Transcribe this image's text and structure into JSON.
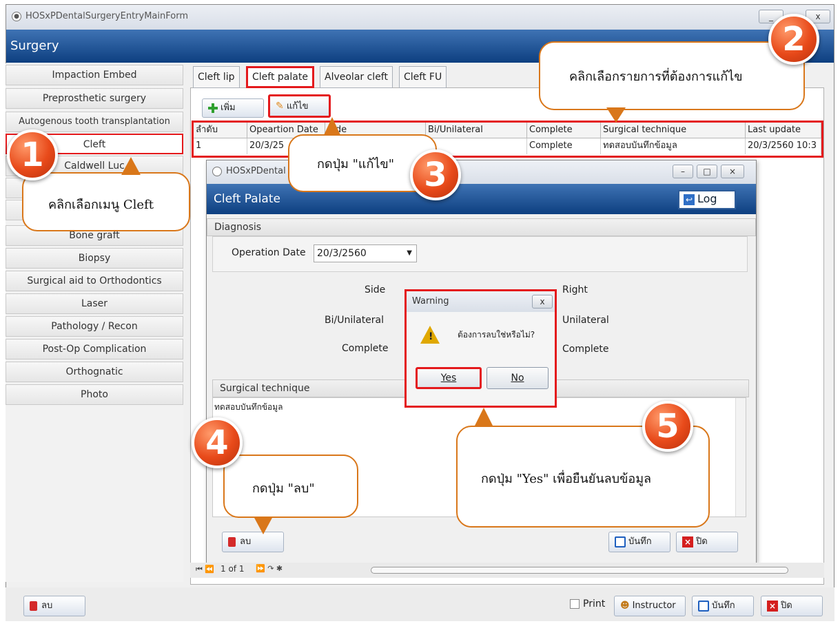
{
  "main_window": {
    "title": "HOSxPDentalSurgeryEntryMainForm",
    "header": "Surgery",
    "min_btn": "_",
    "close_btn": "x"
  },
  "left_menu": {
    "items": [
      "Impaction Embed",
      "Preprosthetic surgery",
      "Autogenous tooth transplantation",
      "Cleft",
      "Caldwell Luc",
      "",
      "",
      "Bone graft",
      "Biopsy",
      "Surgical aid to Orthodontics",
      "Laser",
      "Pathology / Recon",
      "Post-Op Complication",
      "Orthognatic",
      "Photo"
    ]
  },
  "tabs": [
    "Cleft lip",
    "Cleft palate",
    "Alveolar cleft",
    "Cleft FU"
  ],
  "toolbar": {
    "add": "เพิ่ม",
    "edit": "แก้ไข"
  },
  "grid": {
    "headers": [
      "ลำดับ",
      "Opeartion Date",
      "Side",
      "Bi/Unilateral",
      "Complete",
      "Surgical technique",
      "Last update"
    ],
    "row": [
      "1",
      "20/3/25",
      "",
      "",
      "Complete",
      "ทดสอบบันทึกข้อมูล",
      "20/3/2560 10:3"
    ]
  },
  "child_form": {
    "title": "HOSxPDental",
    "header": "Cleft Palate",
    "log_label": "Log",
    "diagnosis_label": "Diagnosis",
    "operation_date_label": "Operation Date",
    "operation_date_value": "20/3/2560",
    "side_label": "Side",
    "side_right": "Right",
    "biuni_label": "Bi/Unilateral",
    "biuni_right": "Unilateral",
    "complete_label": "Complete",
    "complete_right": "Complete",
    "surgical_technique_label": "Surgical technique",
    "surgical_technique_text": "ทดสอบบันทึกข้อมูล",
    "delete_label": "ลบ",
    "save_label": "บันทึก",
    "close_label": "ปิด"
  },
  "warning": {
    "title": "Warning",
    "message": "ต้องการลบใช่หรือไม่?",
    "yes": "Yes",
    "no": "No",
    "close": "x"
  },
  "nav_bar": {
    "record": "1 of 1"
  },
  "bottom_bar": {
    "delete_label": "ลบ",
    "print_label": "Print",
    "instructor_label": "Instructor",
    "save_label": "บันทึก",
    "close_label": "ปิด"
  },
  "callouts": {
    "c1_text": "คลิกเลือกเมนู Cleft",
    "c2_text": "คลิกเลือกรายการที่ต้องการแก้ไข",
    "c3_text": "กดปุ่ม \"แก้ไข\"",
    "c4_text": "กดปุ่ม \"ลบ\"",
    "c5_text": "กดปุ่ม \"Yes\" เพื่อยืนยันลบข้อมูล",
    "badges": [
      "1",
      "2",
      "3",
      "4",
      "5"
    ]
  },
  "colors": {
    "highlight": "#e4191c",
    "header_blue": "#1c4f92",
    "callout_border": "#d9771a",
    "badge": "#e84a1a"
  }
}
